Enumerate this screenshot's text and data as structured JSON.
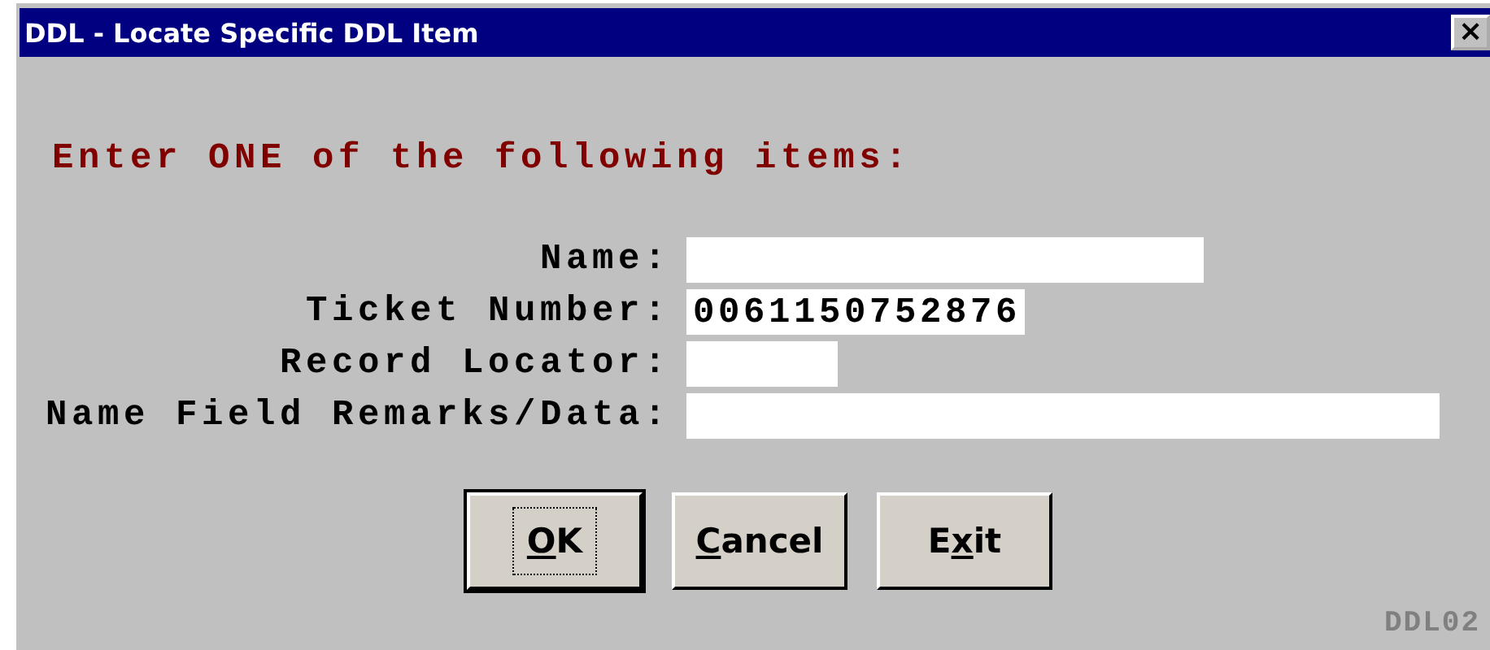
{
  "window": {
    "title": "DDL - Locate Specific DDL Item",
    "close": "×"
  },
  "instruction": "Enter ONE of the following items:",
  "fields": [
    {
      "label": "Name:"
    },
    {
      "label": "Ticket Number:",
      "value": "0061150752876"
    },
    {
      "label": "Record Locator:"
    },
    {
      "label": "Name Field Remarks/Data:"
    }
  ],
  "buttons": [
    {
      "key": "O",
      "after": "K",
      "default": true
    },
    {
      "key": "C",
      "after": "ancel",
      "default": false
    },
    {
      "before": "E",
      "key": "x",
      "after": "it",
      "default": false
    }
  ],
  "screen_id": "DDL02"
}
